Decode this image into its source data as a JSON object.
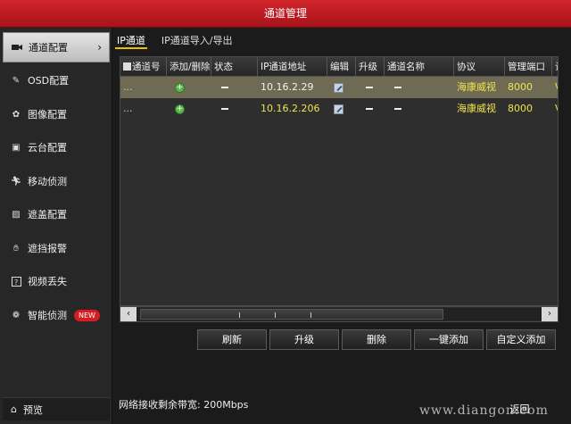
{
  "window": {
    "title": "通道管理"
  },
  "sidebar": {
    "items": [
      {
        "label": "通道配置",
        "icon": "camera-icon",
        "active": true
      },
      {
        "label": "OSD配置",
        "icon": "pencil-icon"
      },
      {
        "label": "图像配置",
        "icon": "palette-icon"
      },
      {
        "label": "云台配置",
        "icon": "ptz-icon"
      },
      {
        "label": "移动侦测",
        "icon": "running-man-icon"
      },
      {
        "label": "遮盖配置",
        "icon": "mask-icon"
      },
      {
        "label": "遮挡报警",
        "icon": "hand-icon"
      },
      {
        "label": "视频丢失",
        "icon": "question-icon"
      },
      {
        "label": "智能侦测",
        "icon": "brain-icon",
        "badge": "NEW"
      }
    ],
    "preview_label": "预览"
  },
  "tabs": [
    {
      "label": "IP通道",
      "active": true
    },
    {
      "label": "IP通道导入/导出",
      "active": false
    }
  ],
  "table": {
    "columns": [
      "通道号",
      "添加/删除",
      "状态",
      "IP通道地址",
      "编辑",
      "升级",
      "通道名称",
      "协议",
      "管理端口",
      "设"
    ],
    "rows": [
      {
        "channel": "...",
        "ip": "10.16.2.29",
        "protocol": "海康威视",
        "port": "8000",
        "extra": "V",
        "selected": true
      },
      {
        "channel": "...",
        "ip": "10.16.2.206",
        "protocol": "海康威视",
        "port": "8000",
        "extra": "V",
        "selected": false
      }
    ]
  },
  "actions": {
    "refresh": "刷新",
    "upgrade": "升级",
    "delete": "删除",
    "one_click_add": "一键添加",
    "custom_add": "自定义添加"
  },
  "footer": {
    "bandwidth": "网络接收剩余带宽: 200Mbps",
    "back": "返回",
    "watermark": "www.diangon.com"
  },
  "colors": {
    "title_red": "#c41c22",
    "highlight_yellow": "#f0e54a",
    "selected_row": "#6f6a54"
  }
}
